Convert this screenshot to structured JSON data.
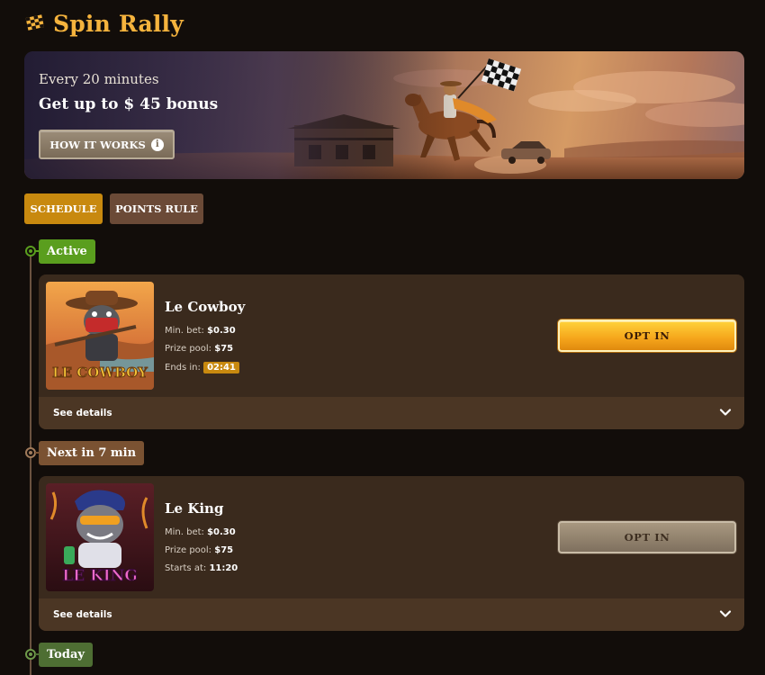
{
  "header": {
    "title": "Spin Rally",
    "icon": "checkered-flag-icon"
  },
  "banner": {
    "subtitle": "Every 20 minutes",
    "headline": "Get up to $ 45 bonus",
    "how_it_works_label": "HOW IT WORKS",
    "info_glyph": "i"
  },
  "tabs": [
    {
      "label": "SCHEDULE",
      "active": true
    },
    {
      "label": "POINTS RULE",
      "active": false
    }
  ],
  "colors": {
    "accent": "#c8890f",
    "active_green": "#5a9e1e",
    "next_brown": "#7a5232",
    "today_green": "#4e6e33",
    "title_gold": "#f5b33d"
  },
  "timeline": [
    {
      "status": "Active",
      "game": {
        "name": "Le Cowboy",
        "thumb_text": "LE COWBOY",
        "min_bet_label": "Min. bet:",
        "min_bet": "$0.30",
        "prize_label": "Prize pool:",
        "prize": "$75",
        "time_label": "Ends in:",
        "time": "02:41",
        "opt_label": "OPT IN",
        "see_details": "See details"
      }
    },
    {
      "status": "Next in 7 min",
      "game": {
        "name": "Le King",
        "thumb_text": "LE KING",
        "min_bet_label": "Min. bet:",
        "min_bet": "$0.30",
        "prize_label": "Prize pool:",
        "prize": "$75",
        "time_label": "Starts at:",
        "time": "11:20",
        "opt_label": "OPT IN",
        "see_details": "See details"
      }
    },
    {
      "status": "Today"
    }
  ]
}
